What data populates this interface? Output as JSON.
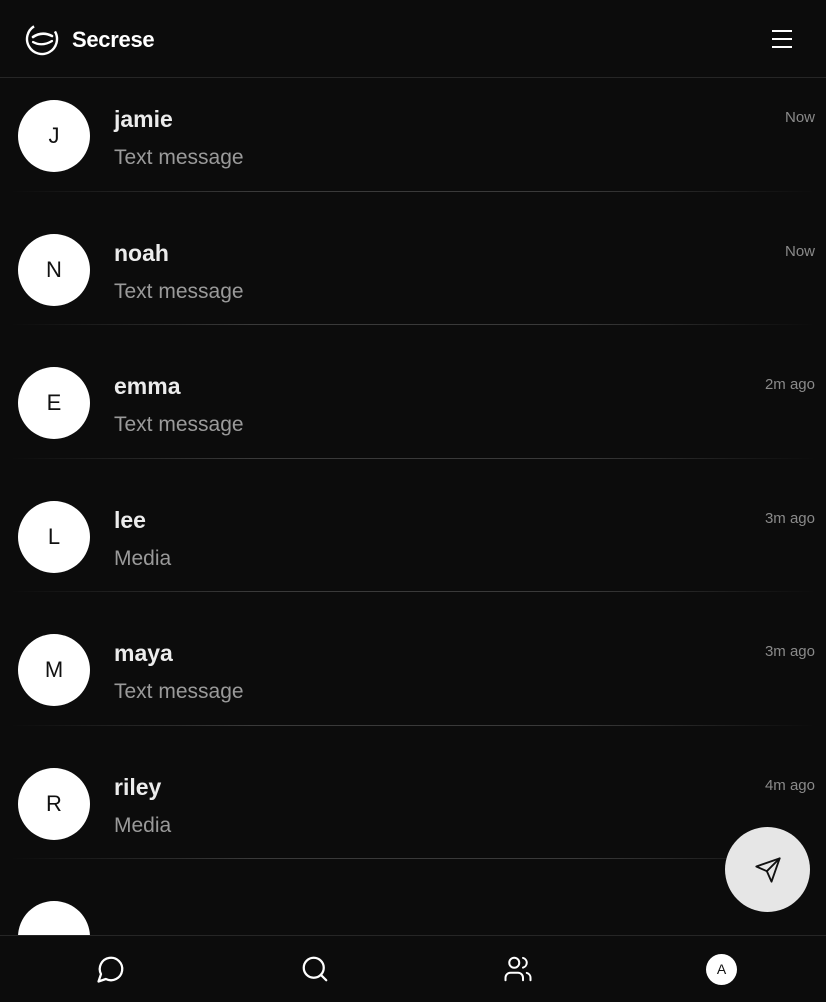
{
  "header": {
    "brand": "Secrese"
  },
  "conversations": [
    {
      "initial": "J",
      "name": "jamie",
      "preview": "Text message",
      "time": "Now"
    },
    {
      "initial": "N",
      "name": "noah",
      "preview": "Text message",
      "time": "Now"
    },
    {
      "initial": "E",
      "name": "emma",
      "preview": "Text message",
      "time": "2m ago"
    },
    {
      "initial": "L",
      "name": "lee",
      "preview": "Media",
      "time": "3m ago"
    },
    {
      "initial": "M",
      "name": "maya",
      "preview": "Text message",
      "time": "3m ago"
    },
    {
      "initial": "R",
      "name": "riley",
      "preview": "Media",
      "time": "4m ago"
    },
    {
      "initial": "",
      "name": "",
      "preview": "",
      "time": ""
    }
  ],
  "bottom_nav": {
    "items": [
      {
        "icon": "chat-icon"
      },
      {
        "icon": "search-icon"
      },
      {
        "icon": "users-icon"
      }
    ],
    "profile_initial": "A"
  },
  "fab": {
    "icon": "send-icon"
  }
}
